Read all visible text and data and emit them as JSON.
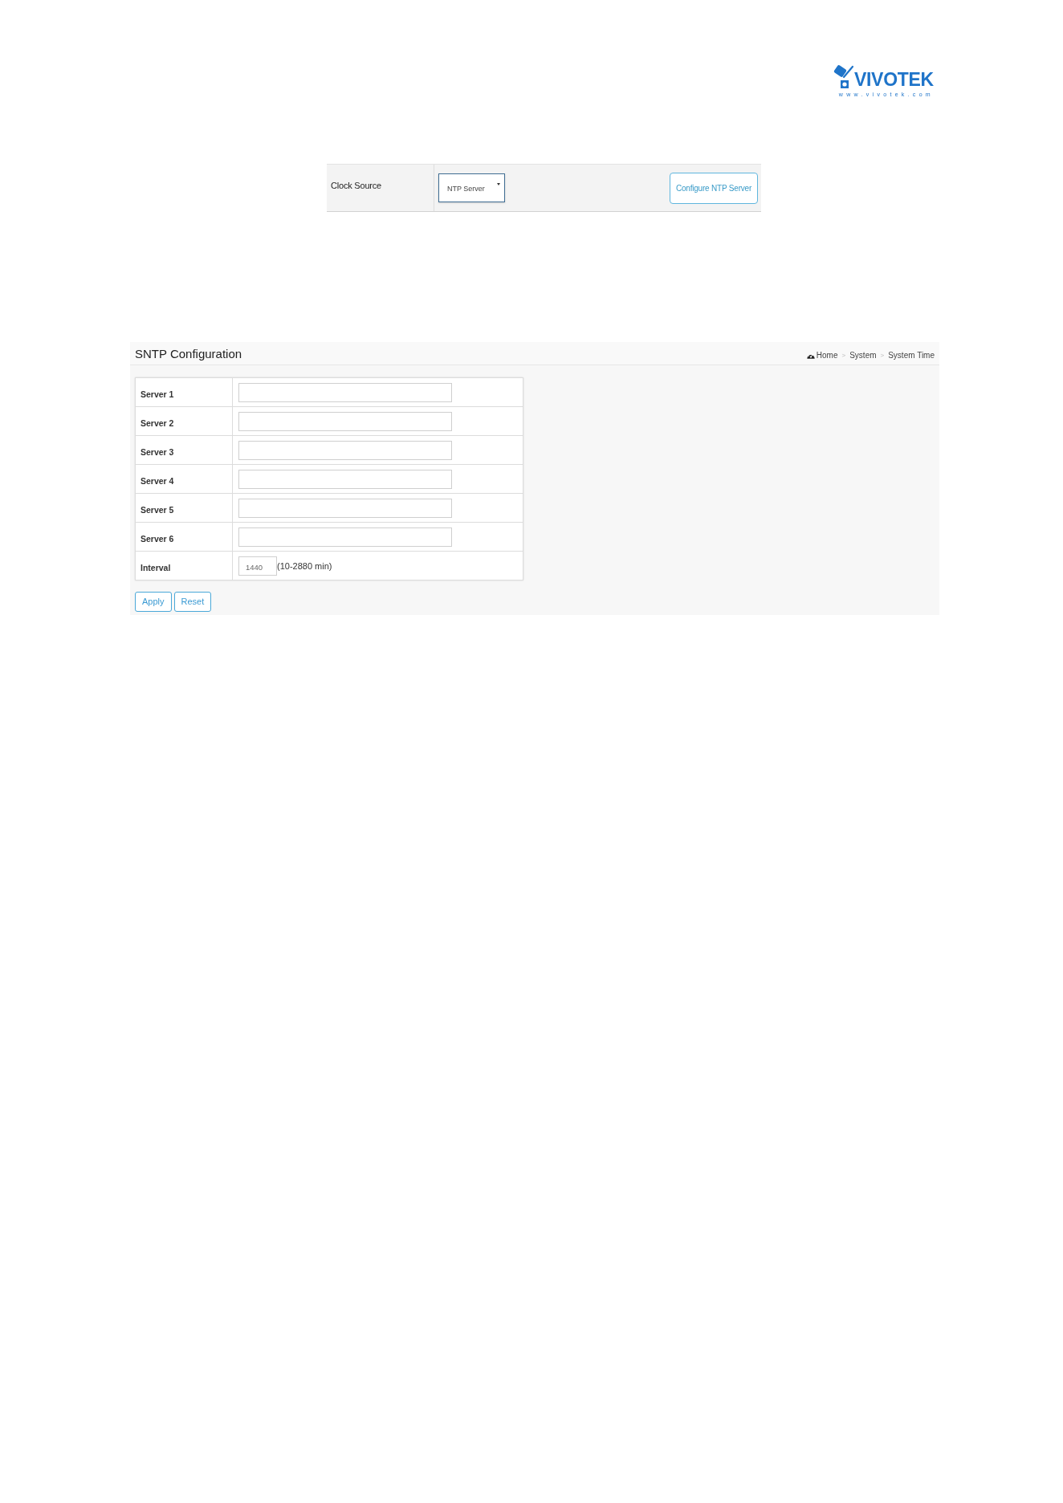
{
  "logo": {
    "wordmark": "VIVOTEK",
    "url": "www.vivotek.com"
  },
  "clock_source": {
    "label": "Clock Source",
    "select": {
      "value": "NTP Server"
    },
    "button": "Configure NTP Server"
  },
  "sntp": {
    "title": "SNTP Configuration",
    "breadcrumb": [
      {
        "kind": "home",
        "label": "Home"
      },
      {
        "kind": "separator",
        "label": ">"
      },
      {
        "kind": "link",
        "label": "System"
      },
      {
        "kind": "separator",
        "label": ">"
      },
      {
        "kind": "link",
        "label": "System Time"
      }
    ],
    "rows": [
      {
        "kind": "server",
        "label": "Server 1"
      },
      {
        "kind": "server",
        "label": "Server 2"
      },
      {
        "kind": "server",
        "label": "Server 3"
      },
      {
        "kind": "server",
        "label": "Server 4"
      },
      {
        "kind": "server",
        "label": "Server 5"
      },
      {
        "kind": "server",
        "label": "Server 6"
      },
      {
        "kind": "interval",
        "label": "Interval",
        "value": "1440",
        "hint": "(10-2880 min)"
      }
    ],
    "buttons": [
      "Apply",
      "Reset"
    ]
  }
}
